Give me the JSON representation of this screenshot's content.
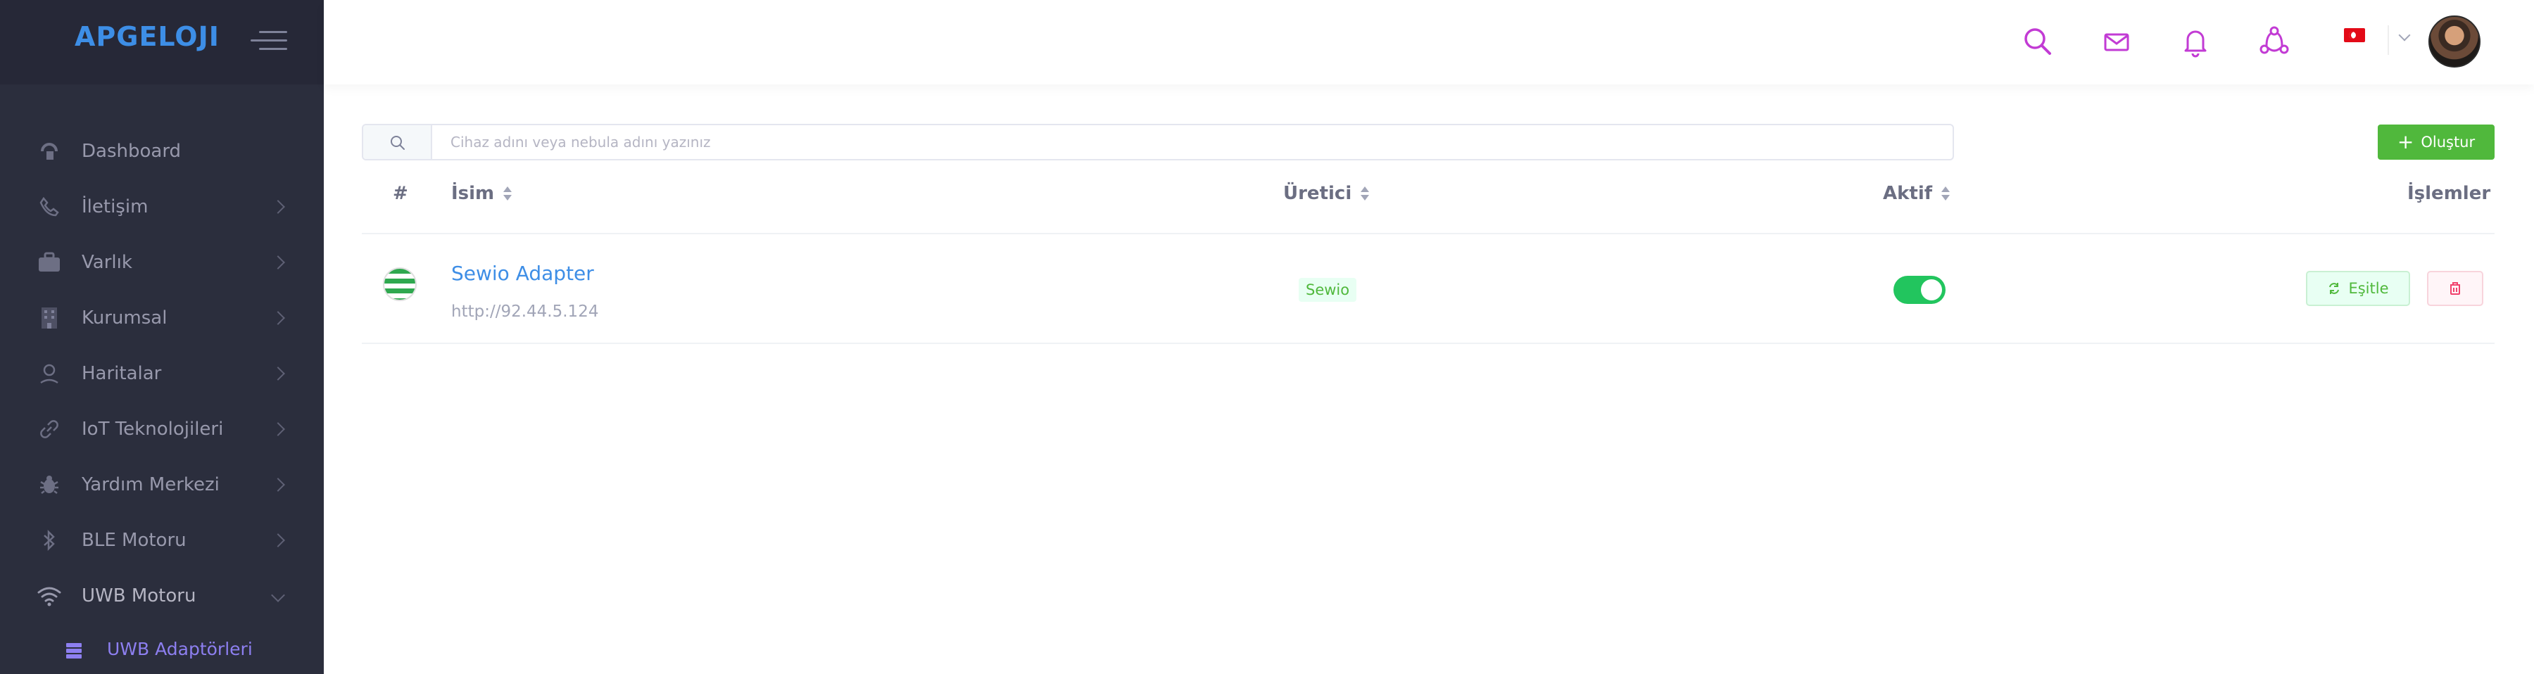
{
  "sidebar": {
    "logo": "APGELOJI",
    "items": [
      {
        "label": "Dashboard",
        "icon": "dashboard-icon"
      },
      {
        "label": "İletişim",
        "icon": "phone-icon"
      },
      {
        "label": "Varlık",
        "icon": "briefcase-icon"
      },
      {
        "label": "Kurumsal",
        "icon": "building-icon"
      },
      {
        "label": "Haritalar",
        "icon": "map-pin-icon"
      },
      {
        "label": "IoT Teknolojileri",
        "icon": "link-icon"
      },
      {
        "label": "Yardım Merkezi",
        "icon": "bug-icon"
      },
      {
        "label": "BLE Motoru",
        "icon": "bluetooth-icon"
      },
      {
        "label": "UWB Motoru",
        "icon": "wifi-icon"
      }
    ],
    "sub_item": {
      "label": "UWB Adaptörleri",
      "icon": "server-icon"
    }
  },
  "header": {
    "icons": [
      "search-icon",
      "mail-icon",
      "bell-icon",
      "share-icon"
    ],
    "language": "tr",
    "colors": {
      "icon": "#c23bd4"
    }
  },
  "search": {
    "placeholder": "Cihaz adını veya nebula adını yazınız"
  },
  "create_button": {
    "label": "Oluştur"
  },
  "table": {
    "columns": {
      "index": "#",
      "name": "İsim",
      "manufacturer": "Üretici",
      "active": "Aktif",
      "actions": "İşlemler"
    },
    "rows": [
      {
        "name": "Sewio Adapter",
        "url": "http://92.44.5.124",
        "manufacturer": "Sewio",
        "active": true,
        "sync_label": "Eşitle"
      }
    ]
  },
  "colors": {
    "sidebar": "#2b2e3d",
    "primary": "#3e8ee6",
    "success": "#50b83c",
    "accent": "#8d7ff0"
  }
}
